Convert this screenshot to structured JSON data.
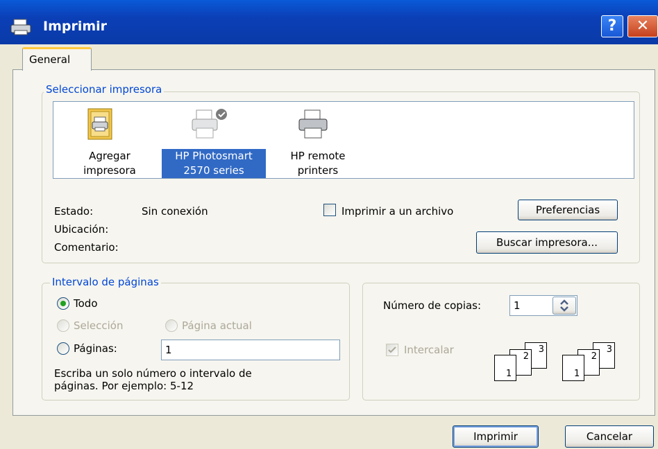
{
  "window": {
    "title": "Imprimir"
  },
  "tabs": [
    {
      "label": "General"
    }
  ],
  "select_printer": {
    "legend": "Seleccionar impresora",
    "printers": [
      {
        "label_line1": "Agregar",
        "label_line2": "impresora",
        "icon": "add-printer-icon"
      },
      {
        "label_line1": "HP Photosmart",
        "label_line2": "2570 series",
        "icon": "printer-default-icon",
        "selected": true
      },
      {
        "label_line1": "HP remote",
        "label_line2": "printers",
        "icon": "printer-icon"
      }
    ],
    "status_label": "Estado:",
    "status_value": "Sin conexión",
    "location_label": "Ubicación:",
    "comment_label": "Comentario:",
    "print_to_file_label": "Imprimir a un archivo",
    "preferences_button": "Preferencias",
    "find_printer_button": "Buscar impresora..."
  },
  "page_range": {
    "legend": "Intervalo de páginas",
    "all_label": "Todo",
    "selection_label": "Selección",
    "current_page_label": "Página actual",
    "pages_label": "Páginas:",
    "pages_value": "1",
    "hint_line1": "Escriba un solo número o intervalo de",
    "hint_line2": "páginas. Por ejemplo: 5-12"
  },
  "copies": {
    "number_label": "Número de copias:",
    "number_value": "1",
    "collate_label": "Intercalar",
    "page_labels": [
      "1",
      "2",
      "3"
    ]
  },
  "footer": {
    "print_button": "Imprimir",
    "cancel_button": "Cancelar"
  }
}
